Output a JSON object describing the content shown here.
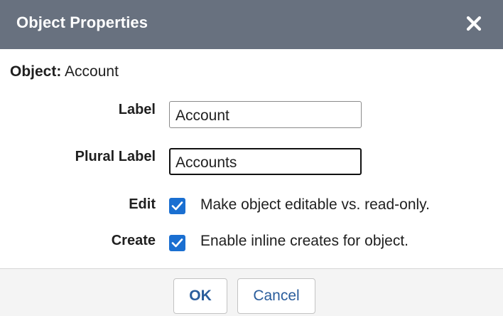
{
  "dialog": {
    "title": "Object Properties",
    "close_icon": "close-icon"
  },
  "object": {
    "label": "Object:",
    "value": "Account"
  },
  "fields": {
    "label": {
      "label": "Label",
      "value": "Account"
    },
    "plural_label": {
      "label": "Plural Label",
      "value": "Accounts"
    }
  },
  "options": {
    "edit": {
      "label": "Edit",
      "checked": true,
      "description": "Make object editable vs. read-only."
    },
    "create": {
      "label": "Create",
      "checked": true,
      "description": "Enable inline creates for object."
    }
  },
  "footer": {
    "ok_label": "OK",
    "cancel_label": "Cancel"
  },
  "colors": {
    "titlebar": "#68717f",
    "checkbox": "#1a6fd1",
    "button_text": "#2a5d9c"
  }
}
